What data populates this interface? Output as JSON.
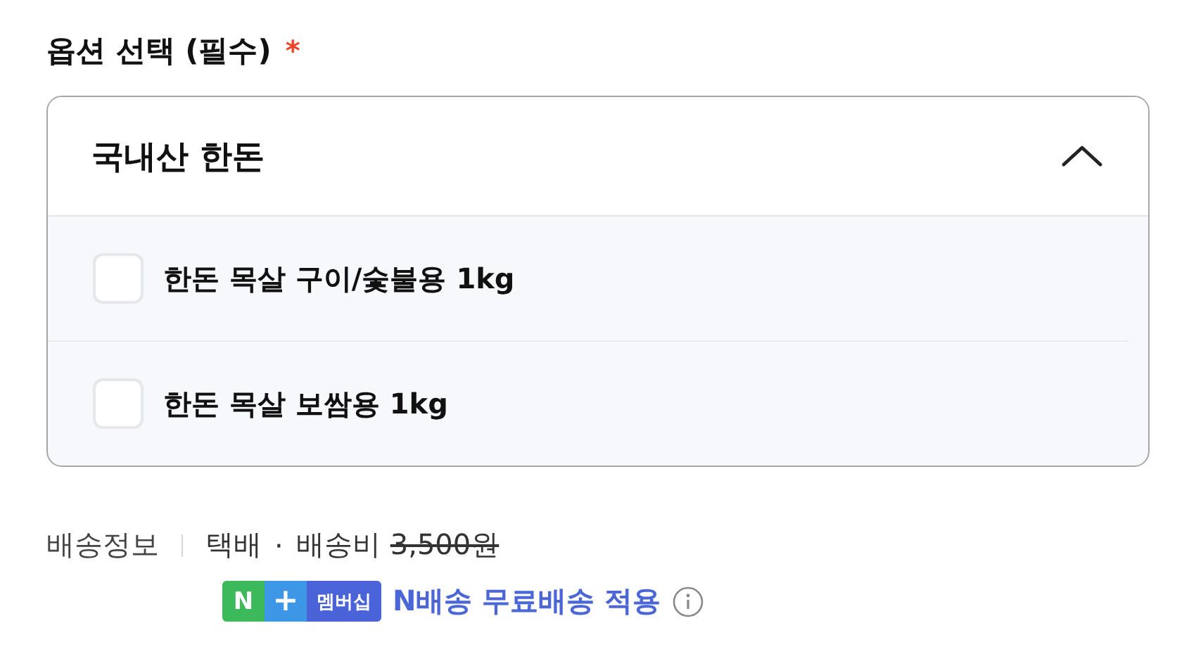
{
  "section": {
    "title": "옵션 선택 (필수)",
    "required_mark": "*"
  },
  "dropdown": {
    "label": "국내산 한돈",
    "expanded": true,
    "options": [
      {
        "label": "한돈 목살 구이/숯불용 1kg",
        "checked": false
      },
      {
        "label": "한돈 목살 보쌈용 1kg",
        "checked": false
      }
    ]
  },
  "shipping": {
    "label": "배송정보",
    "method": "택배",
    "separator": "·",
    "fee_label": "배송비",
    "fee": "3,500원",
    "fee_struck": true,
    "badge": {
      "n": "N",
      "plus": "+",
      "membership": "멤버십"
    },
    "benefit": "N배송 무료배송 적용"
  }
}
